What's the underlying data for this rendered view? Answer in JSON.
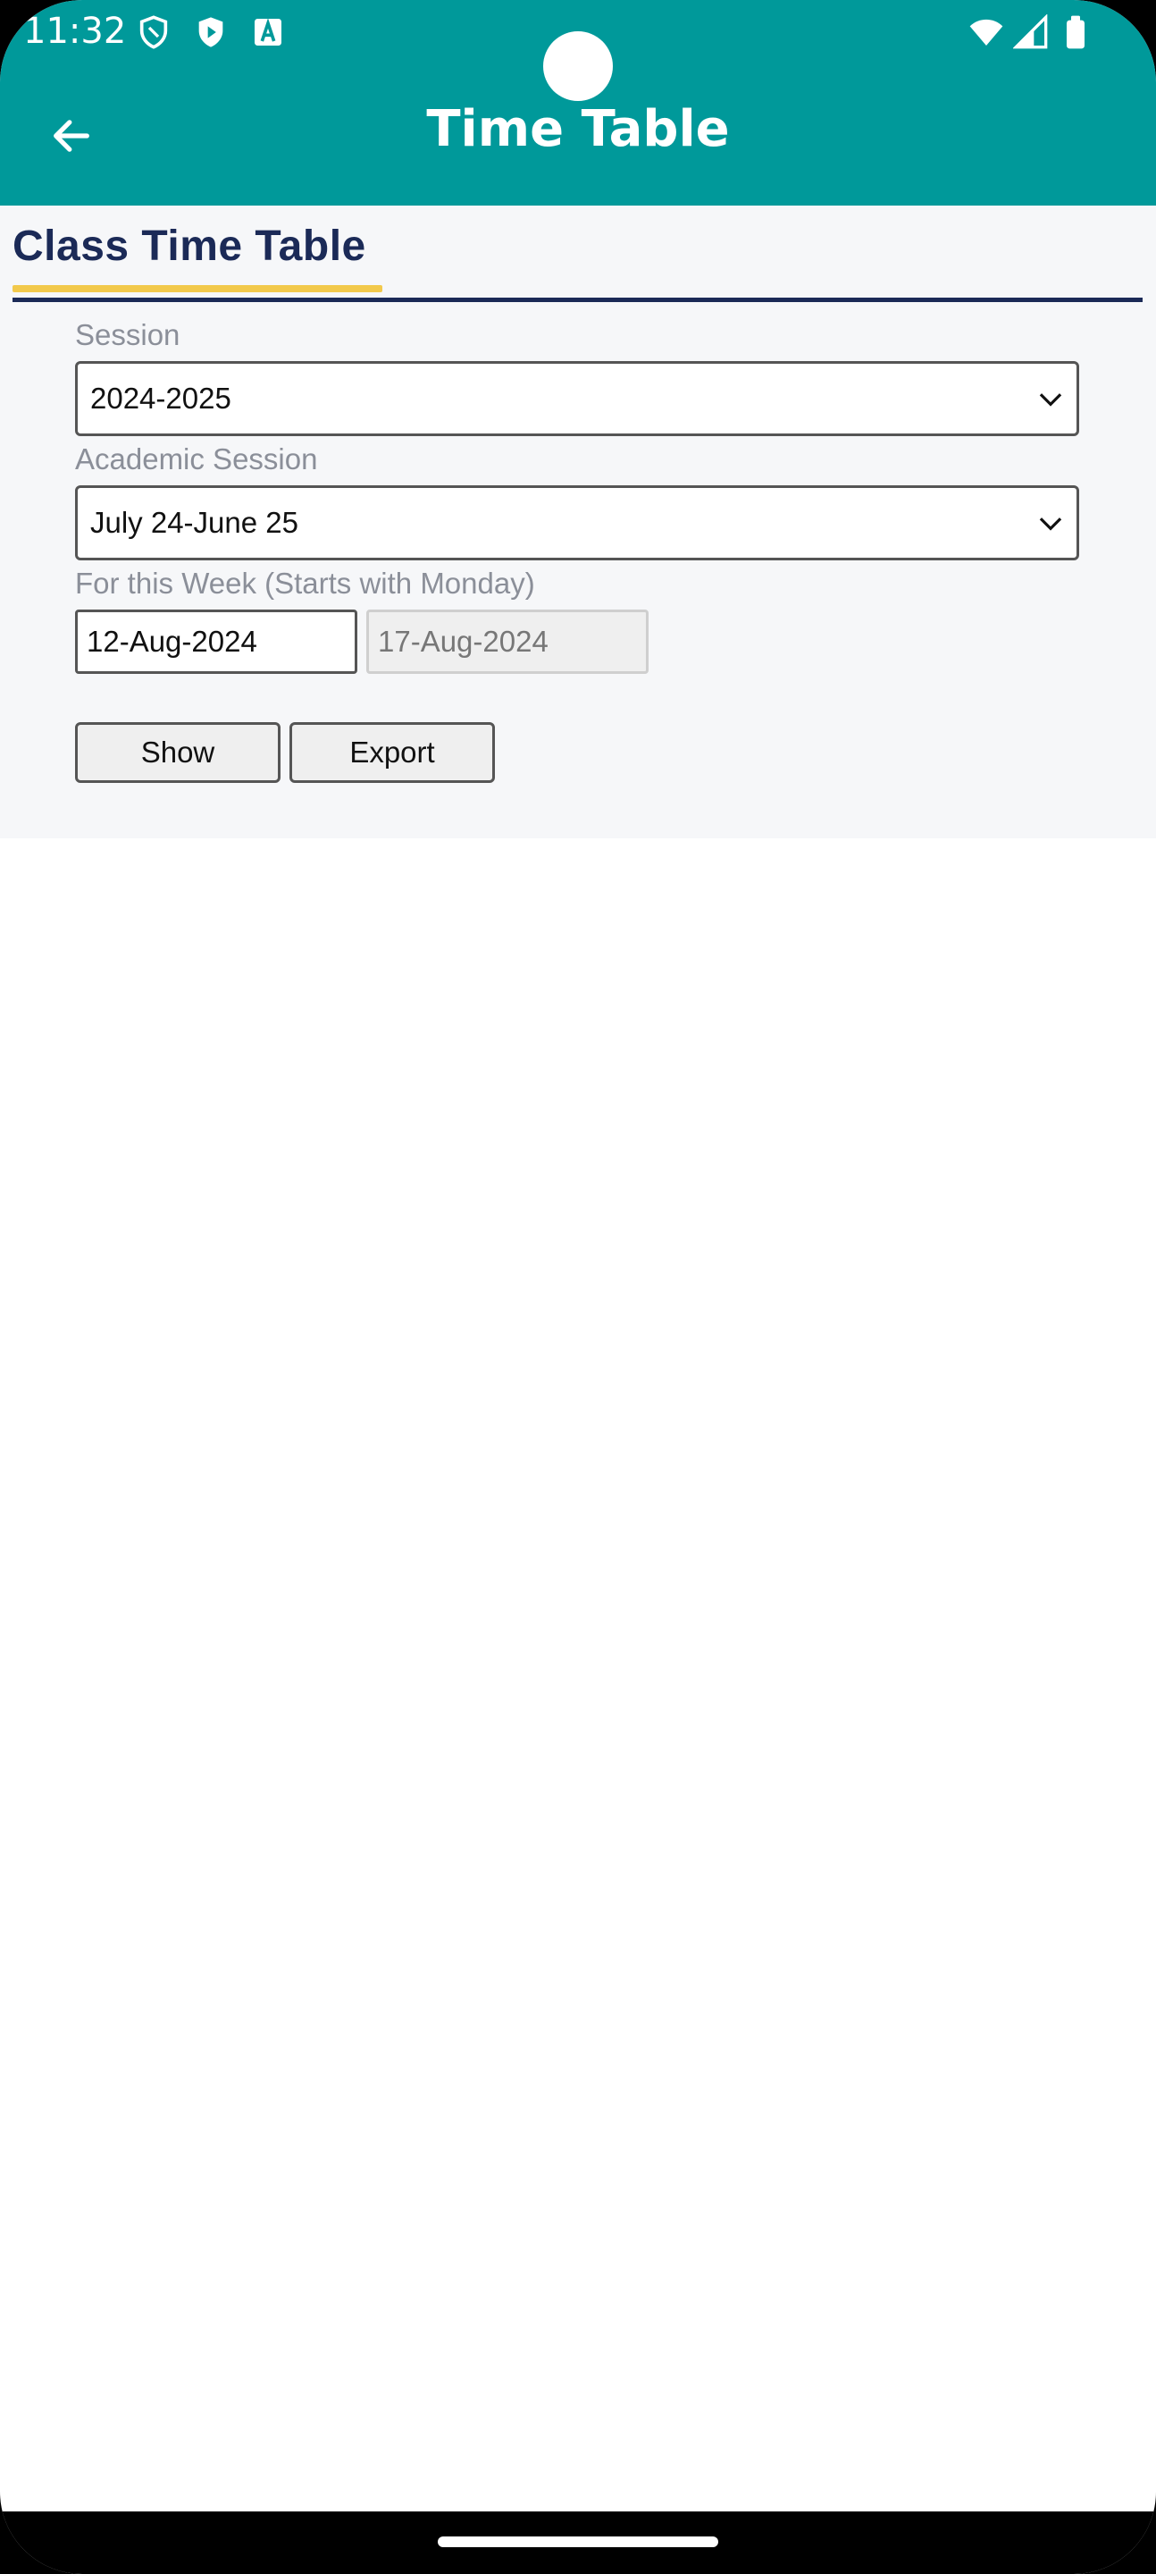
{
  "status_bar": {
    "time": "11:32",
    "icons": [
      "shield-outline-icon",
      "play-shield-icon",
      "font-a-icon",
      "wifi-icon",
      "signal-icon",
      "battery-icon"
    ]
  },
  "app_bar": {
    "title": "Time Table",
    "back_icon": "arrow-left-icon",
    "color": "#00999a"
  },
  "page": {
    "title": "Class Time Table",
    "title_color": "#1b2a57",
    "accent_color": "#f2c94c"
  },
  "form": {
    "session": {
      "label": "Session",
      "value": "2024-2025"
    },
    "academic_session": {
      "label": "Academic Session",
      "value": "July 24-June 25"
    },
    "week": {
      "label": "For this Week (Starts with Monday)",
      "start": "12-Aug-2024",
      "end": "17-Aug-2024"
    },
    "buttons": {
      "show": "Show",
      "export": "Export"
    }
  }
}
